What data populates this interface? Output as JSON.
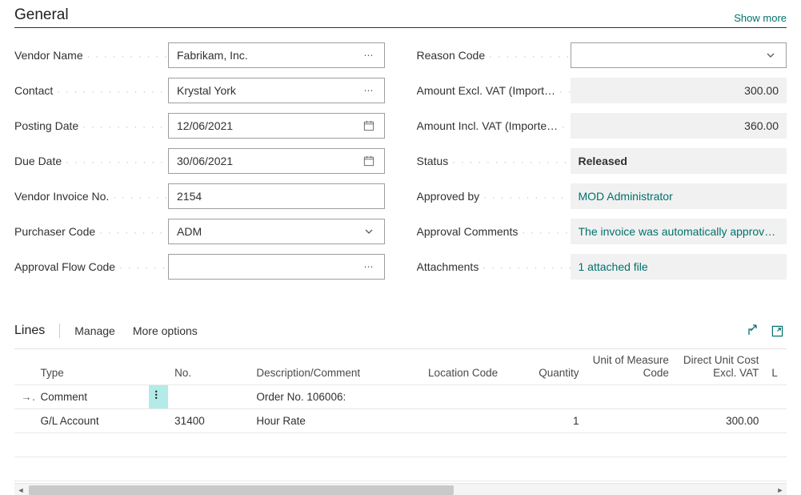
{
  "section": {
    "title": "General",
    "show_more": "Show more"
  },
  "general": {
    "left": {
      "vendor_name": {
        "label": "Vendor Name",
        "value": "Fabrikam, Inc."
      },
      "contact": {
        "label": "Contact",
        "value": "Krystal York"
      },
      "posting_date": {
        "label": "Posting Date",
        "value": "12/06/2021"
      },
      "due_date": {
        "label": "Due Date",
        "value": "30/06/2021"
      },
      "vendor_invoice_no": {
        "label": "Vendor Invoice No.",
        "value": "2154"
      },
      "purchaser_code": {
        "label": "Purchaser Code",
        "value": "ADM"
      },
      "approval_flow_code": {
        "label": "Approval Flow Code",
        "value": ""
      }
    },
    "right": {
      "reason_code": {
        "label": "Reason Code",
        "value": ""
      },
      "amount_excl": {
        "label": "Amount Excl. VAT (Import…",
        "value": "300.00"
      },
      "amount_incl": {
        "label": "Amount Incl. VAT (Importe…",
        "value": "360.00"
      },
      "status": {
        "label": "Status",
        "value": "Released"
      },
      "approved_by": {
        "label": "Approved by",
        "value": "MOD Administrator"
      },
      "approval_comments": {
        "label": "Approval Comments",
        "value": "The invoice was automatically approv…"
      },
      "attachments": {
        "label": "Attachments",
        "value": "1 attached file"
      }
    }
  },
  "lines_header": {
    "title": "Lines",
    "manage": "Manage",
    "more_options": "More options"
  },
  "grid": {
    "columns": {
      "type": "Type",
      "no": "No.",
      "description": "Description/Comment",
      "location": "Location Code",
      "quantity": "Quantity",
      "uom": "Unit of Measure Code",
      "cost": "Direct Unit Cost Excl. VAT",
      "l": "L"
    },
    "rows": [
      {
        "type": "Comment",
        "no": "",
        "description": "Order No. 106006:",
        "location": "",
        "quantity": "",
        "uom": "",
        "cost": ""
      },
      {
        "type": "G/L Account",
        "no": "31400",
        "description": "Hour Rate",
        "location": "",
        "quantity": "1",
        "uom": "",
        "cost": "300.00"
      },
      {
        "type": "",
        "no": "",
        "description": "",
        "location": "",
        "quantity": "",
        "uom": "",
        "cost": ""
      },
      {
        "type": "",
        "no": "",
        "description": "",
        "location": "",
        "quantity": "",
        "uom": "",
        "cost": ""
      }
    ]
  }
}
